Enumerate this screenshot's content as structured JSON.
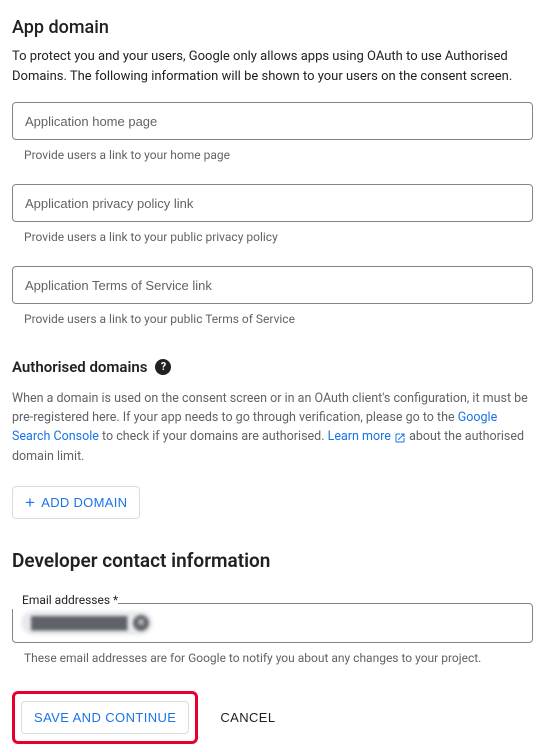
{
  "app_domain": {
    "title": "App domain",
    "description": "To protect you and your users, Google only allows apps using OAuth to use Authorised Domains. The following information will be shown to your users on the consent screen.",
    "fields": {
      "home_page": {
        "placeholder": "Application home page",
        "helper": "Provide users a link to your home page"
      },
      "privacy": {
        "placeholder": "Application privacy policy link",
        "helper": "Provide users a link to your public privacy policy"
      },
      "tos": {
        "placeholder": "Application Terms of Service link",
        "helper": "Provide users a link to your public Terms of Service"
      }
    }
  },
  "authorised_domains": {
    "title": "Authorised domains",
    "description_pre": "When a domain is used on the consent screen or in an OAuth client's configuration, it must be pre-registered here. If your app needs to go through verification, please go to the ",
    "link1_text": "Google Search Console",
    "description_mid": " to check if your domains are authorised. ",
    "link2_text": "Learn more",
    "description_post": " about the authorised domain limit.",
    "add_button": "ADD DOMAIN"
  },
  "developer_contact": {
    "title": "Developer contact information",
    "email_label": "Email addresses *",
    "chip_text": "████████████",
    "helper": "These email addresses are for Google to notify you about any changes to your project."
  },
  "buttons": {
    "save": "SAVE AND CONTINUE",
    "cancel": "CANCEL"
  }
}
